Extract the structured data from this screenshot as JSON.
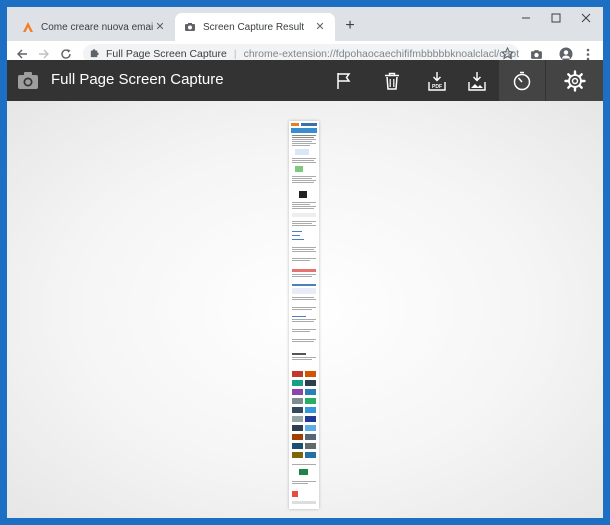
{
  "tabs": [
    {
      "title": "Come creare nuova email | Salvatore",
      "icon": "aranzulla-logo-icon"
    },
    {
      "title": "Screen Capture Result",
      "icon": "camera-icon"
    }
  ],
  "window_controls": {
    "minimize": "–",
    "maximize": "☐",
    "close": "✕"
  },
  "omnibox": {
    "extension_name": "Full Page Screen Capture",
    "url": "chrome-extension://fdpohaocaechififmbbbbbknoalclacl/capture..."
  },
  "app": {
    "title": "Full Page Screen Capture",
    "buttons": [
      "flag-icon",
      "trash-icon",
      "download-pdf-icon",
      "download-image-icon",
      "timer-icon",
      "settings-gear-icon"
    ]
  },
  "colors": {
    "header_bg": "#333333",
    "accent_frame": "#1d6fc4",
    "tab_strip": "#dee1e6"
  }
}
